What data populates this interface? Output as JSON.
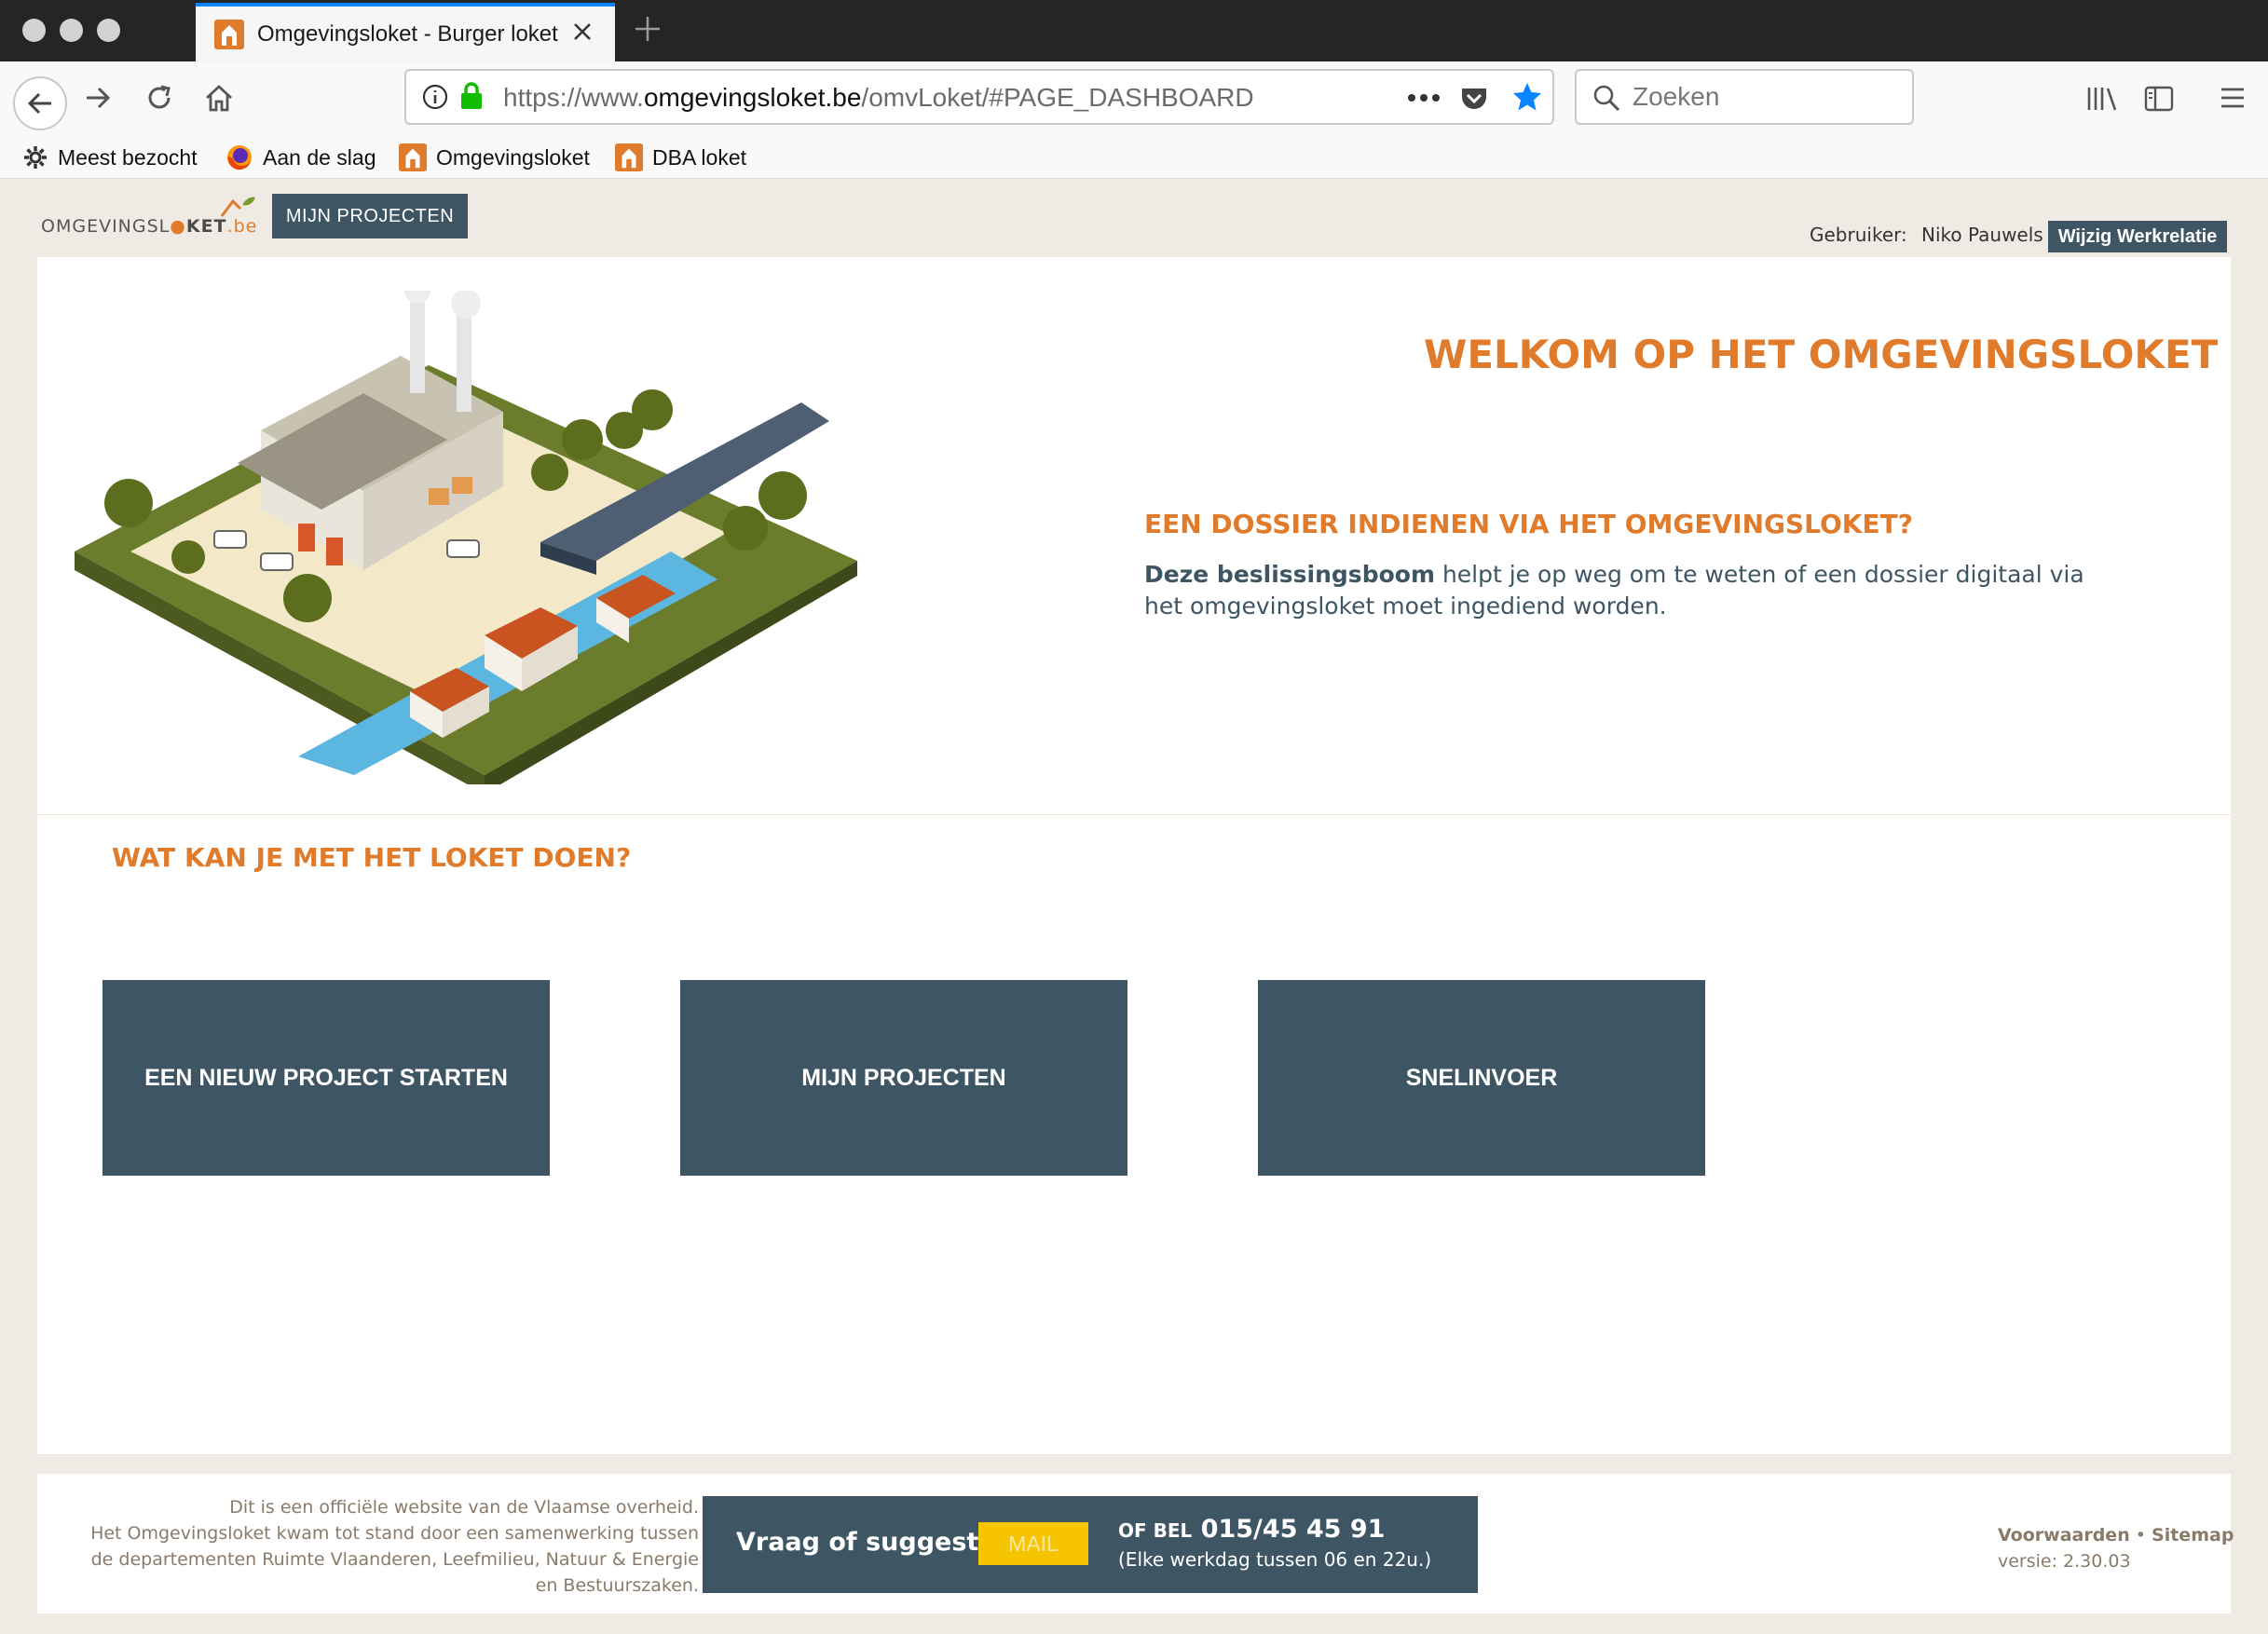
{
  "browser": {
    "tab_title": "Omgevingsloket - Burger loket",
    "url_prefix": "https://www.",
    "url_host": "omgevingsloket.be",
    "url_path": "/omvLoket/#PAGE_DASHBOARD",
    "search_placeholder": "Zoeken",
    "bookmarks": [
      "Meest bezocht",
      "Aan de slag",
      "Omgevingsloket",
      "DBA loket"
    ]
  },
  "header": {
    "logo_text_1": "OMGEVINGSL",
    "logo_text_2": "KET",
    "logo_text_3": ".be",
    "nav_button": "MIJN PROJECTEN",
    "user_label": "Gebruiker:",
    "user_name": "Niko Pauwels",
    "change_button": "Wijzig Werkrelatie"
  },
  "hero": {
    "title": "WELKOM OP HET OMGEVINGSLOKET",
    "subtitle": "EEN DOSSIER INDIENEN VIA HET OMGEVINGSLOKET?",
    "intro_link": "Deze beslissingsboom",
    "intro_rest": " helpt je op weg om te weten of een dossier digitaal via het omgevingsloket moet ingediend worden."
  },
  "actions": {
    "title": "WAT KAN JE MET HET LOKET DOEN?",
    "tiles": [
      "EEN NIEUW PROJECT STARTEN",
      "MIJN PROJECTEN",
      "SNELINVOER"
    ]
  },
  "footer": {
    "left_lines": [
      "Dit is een officiële website van de Vlaamse overheid.",
      "Het Omgevingsloket kwam tot stand door een samenwerking tussen",
      "de departementen Ruimte Vlaanderen, Leefmilieu, Natuur & Energie",
      "en Bestuurszaken."
    ],
    "question": "Vraag of suggestie?",
    "mail_button": "MAIL",
    "call_prefix": "OF BEL",
    "phone": "015/45 45 91",
    "hours": "(Elke werkdag tussen 06 en 22u.)",
    "terms_link": "Voorwaarden",
    "separator": " • ",
    "sitemap_link": "Sitemap",
    "version": "versie: 2.30.03"
  },
  "colors": {
    "accent": "#e07b2c",
    "primary": "#3e5664",
    "mail": "#f7c400"
  }
}
